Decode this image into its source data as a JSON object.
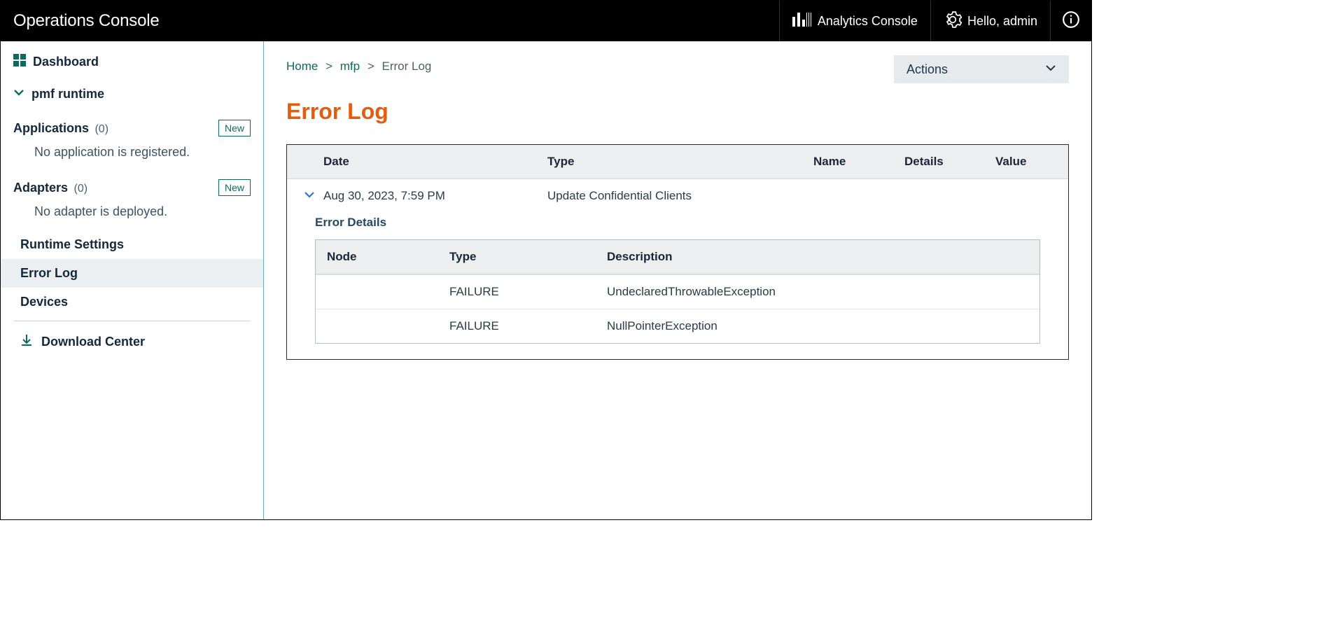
{
  "topbar": {
    "title": "Operations Console",
    "analytics": "Analytics Console",
    "hello": "Hello, admin"
  },
  "sidebar": {
    "dashboard": "Dashboard",
    "runtime": "pmf runtime",
    "applications": {
      "label": "Applications",
      "count": "(0)",
      "new": "New",
      "empty": "No application is registered."
    },
    "adapters": {
      "label": "Adapters",
      "count": "(0)",
      "new": "New",
      "empty": "No adapter is deployed."
    },
    "runtime_settings": "Runtime Settings",
    "error_log": "Error Log",
    "devices": "Devices",
    "download_center": "Download Center"
  },
  "breadcrumb": {
    "home": "Home",
    "mfp": "mfp",
    "current": "Error Log"
  },
  "actions_label": "Actions",
  "page_title": "Error Log",
  "columns": {
    "date": "Date",
    "type": "Type",
    "name": "Name",
    "details": "Details",
    "value": "Value"
  },
  "row": {
    "date": "Aug 30, 2023, 7:59 PM",
    "type": "Update Confidential Clients"
  },
  "details": {
    "title": "Error Details",
    "cols": {
      "node": "Node",
      "type": "Type",
      "desc": "Description"
    },
    "rows": [
      {
        "node": "",
        "type": "FAILURE",
        "desc": "UndeclaredThrowableException"
      },
      {
        "node": "",
        "type": "FAILURE",
        "desc": "NullPointerException"
      }
    ]
  }
}
